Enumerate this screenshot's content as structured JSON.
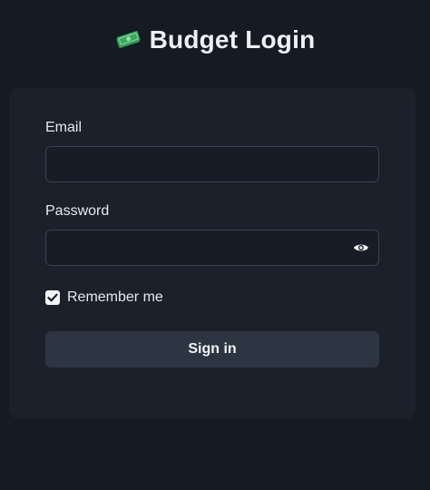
{
  "header": {
    "icon": "money-banknote-icon",
    "title": "Budget Login"
  },
  "form": {
    "email_label": "Email",
    "email_value": "",
    "password_label": "Password",
    "password_value": "",
    "show_password_icon": "eye-icon",
    "remember_label": "Remember me",
    "remember_checked": true,
    "submit_label": "Sign in"
  },
  "colors": {
    "background": "#161a23",
    "card": "#1c202b",
    "button": "#2d3442",
    "money_green": "#3aa55d"
  }
}
